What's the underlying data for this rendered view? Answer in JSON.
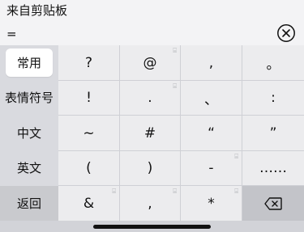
{
  "clipboard": {
    "title": "来自剪贴板",
    "content": "="
  },
  "icons": {
    "clear": "clear-circle-x-icon",
    "delete": "backspace-icon",
    "lock": "lock-icon"
  },
  "categories": [
    {
      "label": "常用",
      "active": true
    },
    {
      "label": "表情符号",
      "active": false
    },
    {
      "label": "中文",
      "active": false
    },
    {
      "label": "英文",
      "active": false
    },
    {
      "label": "返回",
      "active": false
    }
  ],
  "symbols": {
    "r0": [
      "?",
      "@",
      ",",
      "。"
    ],
    "r1": [
      "!",
      ".",
      "、",
      ":"
    ],
    "r2": [
      "~",
      "#",
      "“",
      "”"
    ],
    "r3": [
      "(",
      ")",
      "-",
      "……"
    ],
    "r4": [
      "&",
      ",",
      "*"
    ]
  },
  "lock_glyph": "⌸"
}
